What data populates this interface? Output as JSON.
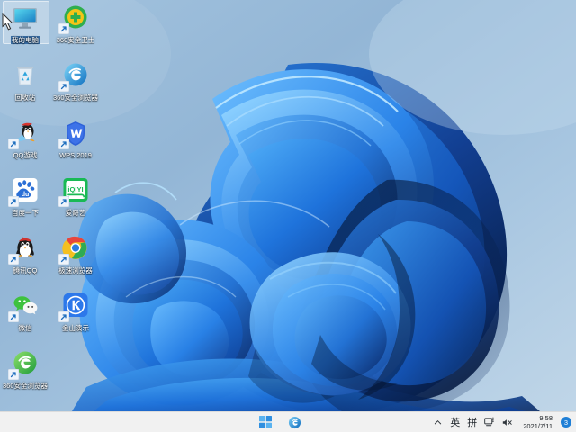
{
  "desktop": {
    "wallpaper_name": "windows-11-bloom-wallpaper",
    "background_color": "#93b6d6",
    "accent_color": "#1f7fd6"
  },
  "icons": [
    {
      "name": "this-pc",
      "label": "我的电脑",
      "art": "monitor",
      "shortcut": false,
      "selected": true
    },
    {
      "name": "360-safe-guard",
      "label": "360安全卫士",
      "art": "360guard",
      "shortcut": true,
      "selected": false
    },
    {
      "name": "recycle-bin",
      "label": "回收站",
      "art": "recycle-bin",
      "shortcut": false,
      "selected": false
    },
    {
      "name": "ie-browser",
      "label": "360安全浏览器",
      "art": "ie-blue",
      "shortcut": true,
      "selected": false
    },
    {
      "name": "qq-games",
      "label": "QQ游戏",
      "art": "qq-penguin",
      "shortcut": true,
      "selected": false
    },
    {
      "name": "wps-office",
      "label": "WPS 2019",
      "art": "wps",
      "shortcut": true,
      "selected": false
    },
    {
      "name": "baidu-yixia",
      "label": "百度一下",
      "art": "baidu",
      "shortcut": true,
      "selected": false
    },
    {
      "name": "iqiyi",
      "label": "爱奇艺",
      "art": "iqiyi",
      "shortcut": true,
      "selected": false
    },
    {
      "name": "qq-messenger",
      "label": "腾讯QQ",
      "art": "qq-penguin2",
      "shortcut": true,
      "selected": false
    },
    {
      "name": "360-chrome",
      "label": "极速浏览器",
      "art": "chrome",
      "shortcut": true,
      "selected": false
    },
    {
      "name": "wechat",
      "label": "微信",
      "art": "wechat",
      "shortcut": true,
      "selected": false
    },
    {
      "name": "kingsoft-present",
      "label": "金山演示",
      "art": "kingsoft-k",
      "shortcut": true,
      "selected": false
    },
    {
      "name": "360-secure-browser",
      "label": "360安全浏览器",
      "art": "ie-green",
      "shortcut": true,
      "selected": false
    }
  ],
  "taskbar": {
    "start_label": "开始",
    "edge_label": "Microsoft Edge",
    "tray": {
      "overflow_label": "︿",
      "ime_english": "英",
      "ime_pinyin": "拼",
      "network_label": "网络",
      "volume_label": "音量已静音",
      "time": "9:58",
      "date": "2021/7/11",
      "notification_count": "3"
    }
  }
}
